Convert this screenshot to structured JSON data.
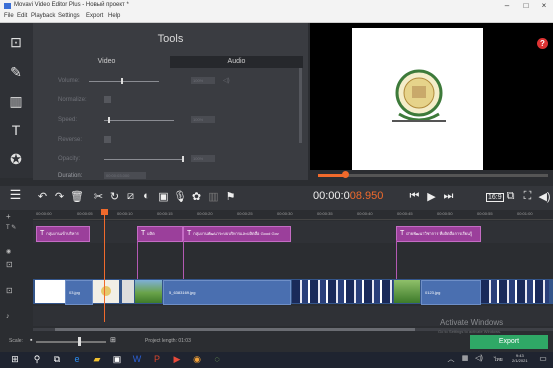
{
  "window": {
    "title": "Movavi Video Editor Plus - Новый проект *",
    "minimize": "–",
    "maximize": "□",
    "close": "×"
  },
  "menu": [
    "File",
    "Edit",
    "Playback",
    "Settings",
    "Export",
    "Help"
  ],
  "tools_panel": {
    "title": "Tools",
    "tabs": [
      "Video",
      "Audio"
    ],
    "rows": [
      {
        "label": "Volume:",
        "value": "100%"
      },
      {
        "label": "Normalize:"
      },
      {
        "label": "Speed:",
        "value": "100%"
      },
      {
        "label": "Reverse:"
      },
      {
        "label": "Opacity:",
        "value": "100%"
      },
      {
        "label": "Duration:",
        "value": "00:00:03.000"
      }
    ]
  },
  "preview": {
    "help": "?"
  },
  "toolbar": {
    "timecode_white": "00:00:0",
    "timecode_orange": "08.950",
    "aspect": "16:9"
  },
  "ruler_ticks": [
    "00:00:00",
    "00:00:05",
    "00:00:10",
    "00:00:15",
    "00:00:20",
    "00:00:25",
    "00:00:30",
    "00:00:35",
    "00:00:40",
    "00:00:45",
    "00:00:50",
    "00:00:55",
    "00:01:00"
  ],
  "title_clips": [
    {
      "text": "กลุ่มงานเข้าบริหาร"
    },
    {
      "text": "ผลิต"
    },
    {
      "text": "กลุ่มงานพัฒนาระบบบริหารและผลิตสื่อ Good Gov"
    },
    {
      "text": "ฝ่ายพัฒนาวิชาการ ที่ผลิตสื่อการเรียนรู้"
    }
  ],
  "video_clips": [
    {
      "text": "03.jpg"
    },
    {
      "text": "5_6383169.jpg"
    },
    {
      "text": "0123.jpg"
    }
  ],
  "bottom": {
    "scale_label": "Scale:",
    "project_length": "Project length: 01:03",
    "export": "Export",
    "activate_title": "Activate Windows",
    "activate_sub": "Go to Settings to activate Windows."
  },
  "taskbar": {
    "time": "9:43",
    "date": "2/1/2021",
    "lang": "ไทย"
  }
}
